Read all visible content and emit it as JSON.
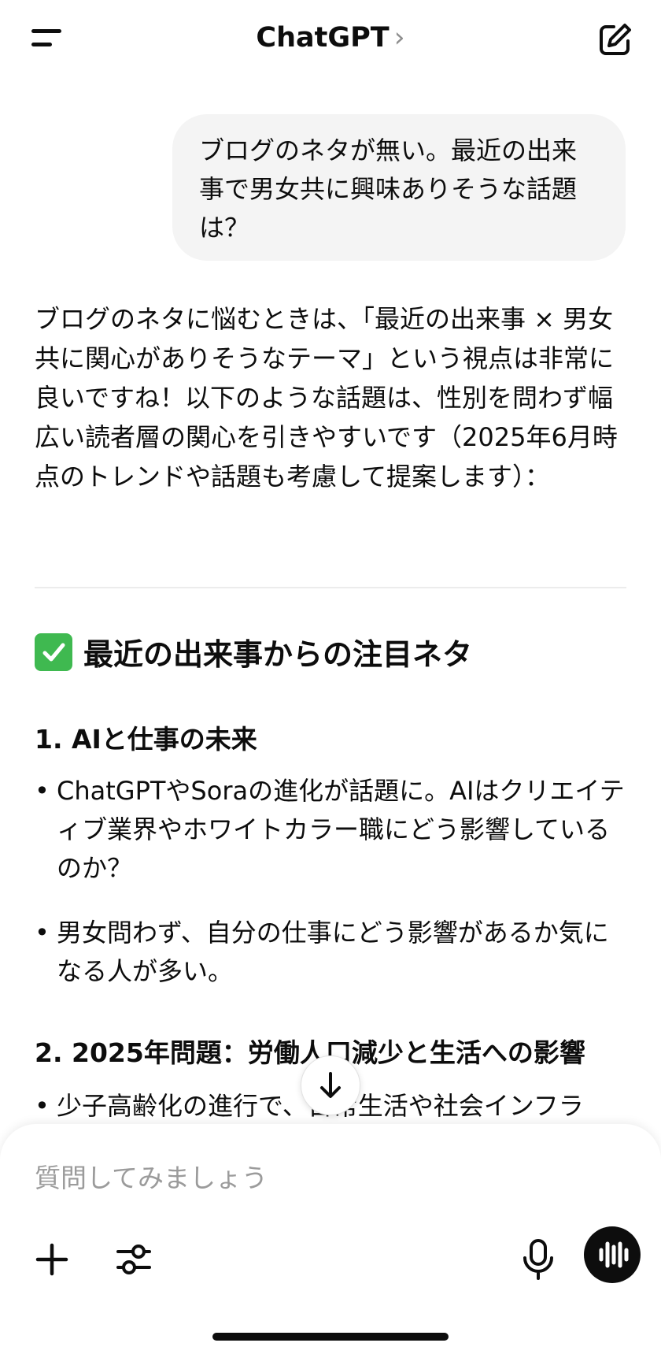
{
  "header": {
    "title": "ChatGPT",
    "chevron": "›",
    "menu_icon": "hamburger-menu-icon",
    "new_chat_icon": "compose-icon"
  },
  "user_message": "ブログのネタが無い。最近の出来事で男女共に興味ありそうな話題は？",
  "assistant": {
    "intro": "ブログのネタに悩むときは、「最近の出来事 × 男女共に関心がありそうなテーマ」という視点は非常に良いですね！以下のような話題は、性別を問わず幅広い読者層の関心を引きやすいです（2025年6月時点のトレンドや話題も考慮して提案します）：",
    "section_title": "最近の出来事からの注目ネタ",
    "section_icon": "check-mark-icon",
    "topics": [
      {
        "title": "1. AIと仕事の未来",
        "bullets": [
          "ChatGPTやSoraの進化が話題に。AIはクリエイティブ業界やホワイトカラー職にどう影響しているのか？",
          "男女問わず、自分の仕事にどう影響があるか気になる人が多い。"
        ]
      },
      {
        "title": "2. 2025年問題：労働人口減少と生活への影響",
        "bullets": [
          "少子高齢化の進行で、日常生活や社会インフラ"
        ]
      }
    ]
  },
  "composer": {
    "placeholder": "質問してみましょう",
    "plus_icon": "plus-icon",
    "tools_icon": "sliders-icon",
    "mic_icon": "microphone-icon",
    "voice_icon": "voice-waveform-icon"
  },
  "scroll_down_icon": "arrow-down-icon",
  "colors": {
    "bubble_bg": "#f4f4f4",
    "text": "#0d0d0d",
    "placeholder": "#9b9b9b",
    "check_green": "#3fb950"
  }
}
